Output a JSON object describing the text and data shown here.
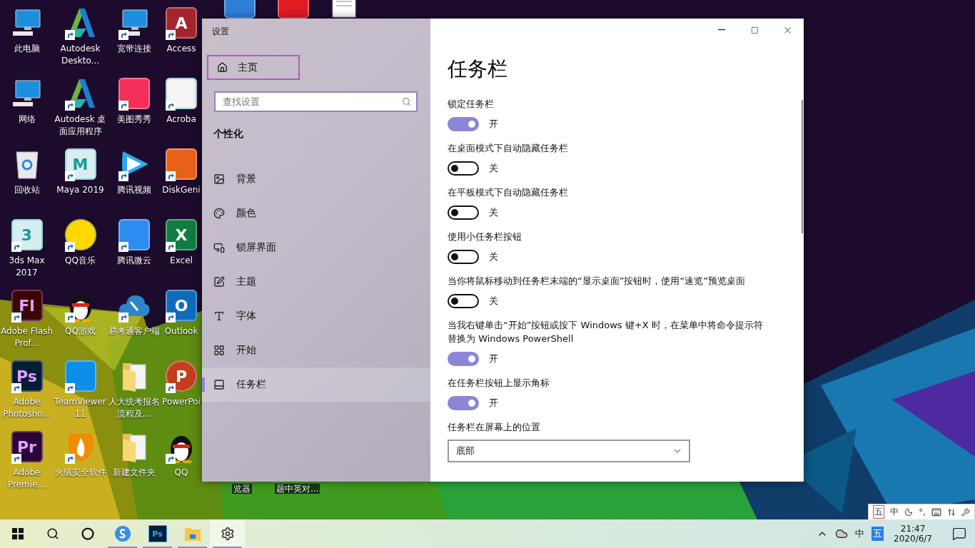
{
  "desktop": {
    "columns": [
      [
        {
          "label": "此电脑",
          "kind": "monitor",
          "shortcut": false
        },
        {
          "label": "网络",
          "kind": "monitor",
          "shortcut": false
        },
        {
          "label": "回收站",
          "kind": "bin",
          "shortcut": false
        },
        {
          "label": "3ds Max 2017",
          "kind": "tile",
          "color": "#d6eeee",
          "glyph": "3",
          "shortcut": true
        },
        {
          "label": "Adobe Flash Prof...",
          "kind": "tile",
          "color": "#3b0500",
          "glyph": "Fl",
          "shortcut": true
        },
        {
          "label": "Adobe Photosho...",
          "kind": "tile",
          "color": "#001e36",
          "glyph": "Ps",
          "shortcut": true
        },
        {
          "label": "Adobe Premie...",
          "kind": "tile",
          "color": "#2a0634",
          "glyph": "Pr",
          "shortcut": true
        }
      ],
      [
        {
          "label": "Autodesk Deskto...",
          "kind": "triangle",
          "shortcut": true
        },
        {
          "label": "Autodesk 桌面应用程序",
          "kind": "triangle",
          "shortcut": true
        },
        {
          "label": "Maya 2019",
          "kind": "tile",
          "color": "#d8eef0",
          "glyph": "M",
          "shortcut": true
        },
        {
          "label": "QQ音乐",
          "kind": "circle",
          "color": "#ffd800",
          "shortcut": true
        },
        {
          "label": "QQ游戏",
          "kind": "penguin",
          "shortcut": true
        },
        {
          "label": "TeamViewer 11",
          "kind": "tile",
          "color": "#0e8ee9",
          "shortcut": true
        },
        {
          "label": "火绒安全软件",
          "kind": "shield",
          "shortcut": true
        }
      ],
      [
        {
          "label": "宽带连接",
          "kind": "monitor",
          "shortcut": true
        },
        {
          "label": "美图秀秀",
          "kind": "tile",
          "color": "#f3305a",
          "shortcut": true
        },
        {
          "label": "腾讯视频",
          "kind": "play",
          "shortcut": true
        },
        {
          "label": "腾讯微云",
          "kind": "tile",
          "color": "#2d8cf0",
          "shortcut": true
        },
        {
          "label": "易考通客户端",
          "kind": "cloud",
          "shortcut": true
        },
        {
          "label": "人大统考报名流程及...",
          "kind": "folder",
          "shortcut": false
        },
        {
          "label": "新建文件夹",
          "kind": "folder",
          "shortcut": false
        }
      ],
      [
        {
          "label": "Access",
          "kind": "tile",
          "color": "#a4262c",
          "glyph": "A",
          "shortcut": true
        },
        {
          "label": "Acroba",
          "kind": "tile",
          "color": "#f4f4f4",
          "shortcut": true
        },
        {
          "label": "DiskGeni",
          "kind": "tile",
          "color": "#e8621a",
          "shortcut": true
        },
        {
          "label": "Excel",
          "kind": "tile",
          "color": "#107c41",
          "glyph": "X",
          "shortcut": true
        },
        {
          "label": "Outlook",
          "kind": "tile",
          "color": "#0f6cbd",
          "glyph": "O",
          "shortcut": true
        },
        {
          "label": "PowerPoi",
          "kind": "circle",
          "color": "#c43e1c",
          "glyph": "P",
          "shortcut": true
        },
        {
          "label": "QQ",
          "kind": "penguin",
          "shortcut": true
        }
      ]
    ],
    "peeking_icons": [
      {
        "kind": "tile",
        "color": "#2f7fd8"
      },
      {
        "kind": "tile",
        "color": "#e01b24"
      },
      {
        "kind": "document"
      }
    ],
    "labels_below_window": [
      "览器",
      "题中英对..."
    ]
  },
  "settings_window": {
    "title": "设置",
    "controls": [
      {
        "kind": "minimize"
      },
      {
        "kind": "maximize"
      },
      {
        "kind": "close"
      }
    ],
    "home": {
      "label": "主页",
      "focused": true
    },
    "search": {
      "placeholder": "查找设置"
    },
    "section": "个性化",
    "nav": [
      {
        "label": "背景",
        "kind": "picture",
        "selected": false
      },
      {
        "label": "颜色",
        "kind": "palette",
        "selected": false
      },
      {
        "label": "锁屏界面",
        "kind": "lockscreen",
        "selected": false
      },
      {
        "label": "主题",
        "kind": "theme",
        "selected": false
      },
      {
        "label": "字体",
        "kind": "font",
        "selected": false
      },
      {
        "label": "开始",
        "kind": "start",
        "selected": false
      },
      {
        "label": "任务栏",
        "kind": "taskbar",
        "selected": true
      }
    ],
    "page_title": "任务栏",
    "settings": [
      {
        "kind": "toggle",
        "label": "锁定任务栏",
        "on": true,
        "state_text": "开"
      },
      {
        "kind": "toggle",
        "label": "在桌面模式下自动隐藏任务栏",
        "on": false,
        "state_text": "关"
      },
      {
        "kind": "toggle",
        "label": "在平板模式下自动隐藏任务栏",
        "on": false,
        "state_text": "关"
      },
      {
        "kind": "toggle",
        "label": "使用小任务栏按钮",
        "on": false,
        "state_text": "关"
      },
      {
        "kind": "toggle",
        "label": "当你将鼠标移动到任务栏末端的“显示桌面”按钮时，使用“速览”预览桌面",
        "on": false,
        "state_text": "关"
      },
      {
        "kind": "toggle",
        "label": "当我右键单击“开始”按钮或按下 Windows 键+X 时，在菜单中将命令提示符替换为 Windows PowerShell",
        "on": true,
        "state_text": "开"
      },
      {
        "kind": "toggle",
        "label": "在任务栏按钮上显示角标",
        "on": true,
        "state_text": "开"
      },
      {
        "kind": "dropdown",
        "label": "任务栏在屏幕上的位置",
        "value": "底部"
      }
    ]
  },
  "ime_bar": [
    {
      "kind": "text",
      "text": "五",
      "boxed": true
    },
    {
      "kind": "text",
      "text": "中",
      "boxed": false
    },
    {
      "kind": "moon"
    },
    {
      "kind": "text",
      "text": "°,",
      "boxed": false
    },
    {
      "kind": "keyboard"
    },
    {
      "kind": "arrows"
    },
    {
      "kind": "wrench"
    }
  ],
  "taskbar": {
    "apps": [
      {
        "kind": "start",
        "running": false,
        "selected": false
      },
      {
        "kind": "search",
        "running": false,
        "selected": false
      },
      {
        "kind": "cortana",
        "running": false,
        "selected": false
      },
      {
        "kind": "browser",
        "running": true,
        "selected": false
      },
      {
        "kind": "photoshop",
        "glyph": "Ps",
        "running": true,
        "selected": false
      },
      {
        "kind": "explorer",
        "running": true,
        "selected": false
      },
      {
        "kind": "settings",
        "running": true,
        "selected": true
      }
    ],
    "tray": [
      {
        "kind": "chevron"
      },
      {
        "kind": "cloud"
      },
      {
        "kind": "text",
        "text": "中",
        "boxed": false
      },
      {
        "kind": "text",
        "text": "五",
        "boxed": true
      }
    ],
    "time": "21:47",
    "date": "2020/6/7"
  }
}
